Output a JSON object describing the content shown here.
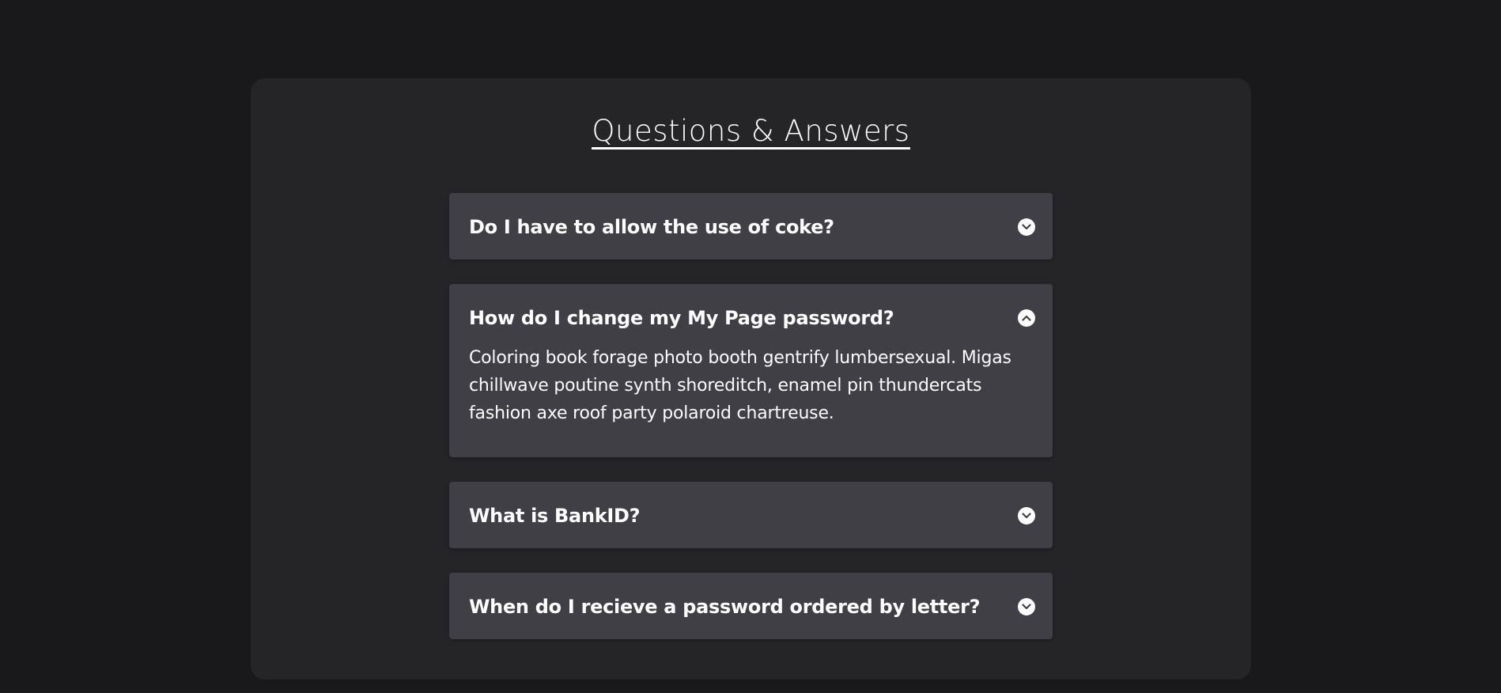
{
  "title": "Questions & Answers",
  "faq": [
    {
      "question": "Do I have to allow the use of coke?",
      "expanded": false,
      "toggle_icon": "chevron-down-icon"
    },
    {
      "question": "How do I change my My Page password?",
      "expanded": true,
      "toggle_icon": "chevron-up-icon",
      "answer": "Coloring book forage photo booth gentrify lumbersexual. Migas chillwave poutine synth shoreditch, enamel pin thundercats fashion axe roof party polaroid chartreuse."
    },
    {
      "question": "What is BankID?",
      "expanded": false,
      "toggle_icon": "chevron-down-icon"
    },
    {
      "question": "When do I recieve a password ordered by letter?",
      "expanded": false,
      "toggle_icon": "chevron-down-icon"
    }
  ],
  "colors": {
    "page_background": "#19191b",
    "card_background": "#252528",
    "item_background": "#3f3f45",
    "text": "#ffffff"
  }
}
